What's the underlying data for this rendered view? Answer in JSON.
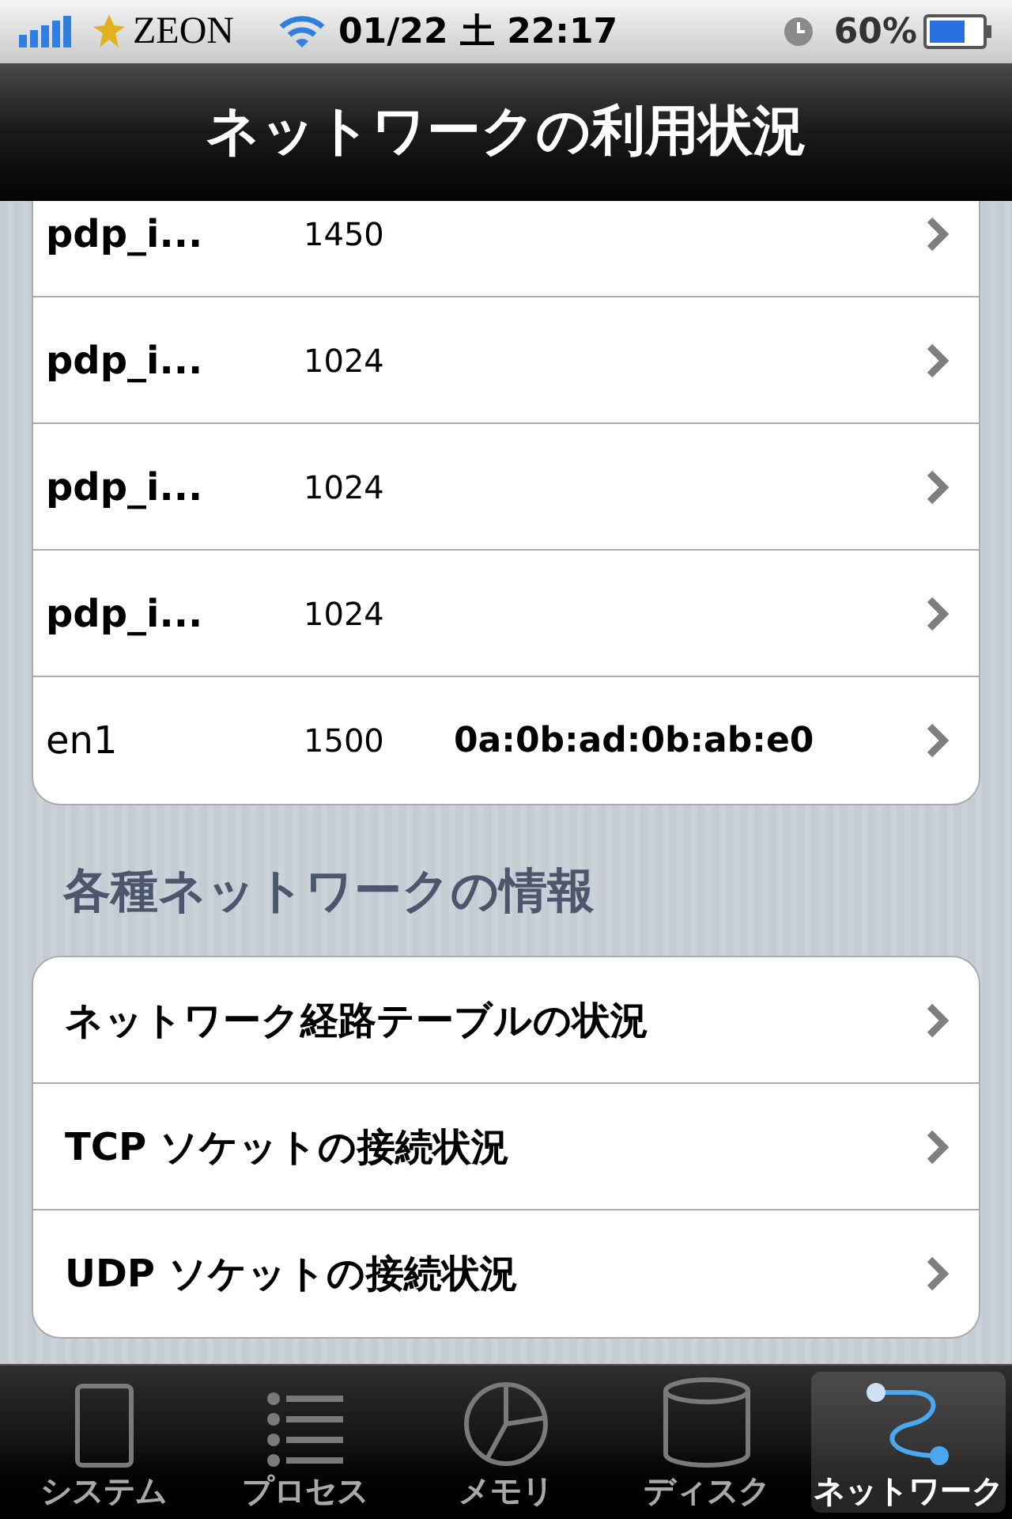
{
  "status_bar": {
    "carrier": "ZEON",
    "time": "01/22 土 22:17",
    "battery": "60%"
  },
  "nav_bar": {
    "title": "ネットワークの利用状況"
  },
  "interfaces": [
    {
      "name": "pdp_i...",
      "mtu": "1450"
    },
    {
      "name": "pdp_i...",
      "mtu": "1024"
    },
    {
      "name": "pdp_i...",
      "mtu": "1024"
    },
    {
      "name": "pdp_i...",
      "mtu": "1024"
    },
    {
      "name": "en1",
      "mtu": "1500",
      "address": "0a:0b:ad:0b:ab:e0"
    }
  ],
  "section": {
    "header": "各種ネットワークの情報",
    "items": [
      {
        "label": "ネットワーク経路テーブルの状況"
      },
      {
        "label": "TCP ソケットの接続状況"
      },
      {
        "label": "UDP ソケットの接続状況"
      }
    ]
  },
  "tab_bar": [
    {
      "label": "システム",
      "kind": "device",
      "selected": false
    },
    {
      "label": "プロセス",
      "kind": "list",
      "selected": false
    },
    {
      "label": "メモリ",
      "kind": "pie",
      "selected": false
    },
    {
      "label": "ディスク",
      "kind": "disk",
      "selected": false
    },
    {
      "label": "ネットワーク",
      "kind": "network",
      "selected": true
    }
  ]
}
